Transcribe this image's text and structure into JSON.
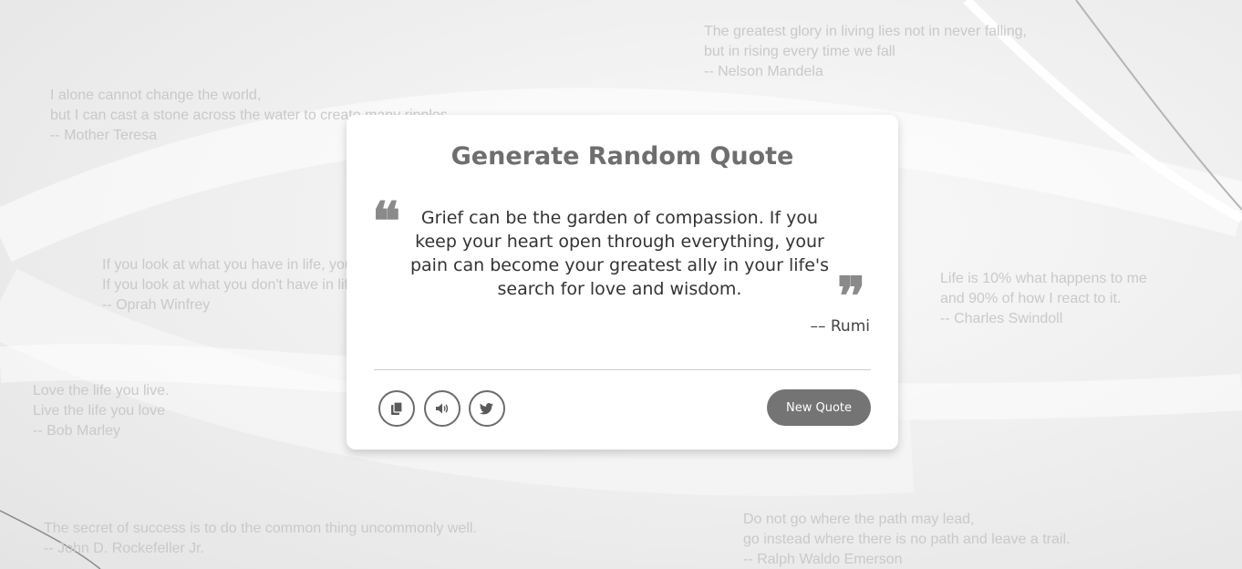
{
  "background_quotes": [
    {
      "lines": [
        "The greatest glory in living lies not in never falling,",
        "but in rising every time we fall",
        "-- Nelson Mandela"
      ]
    },
    {
      "lines": [
        "I alone cannot change the world,",
        "but I can cast a stone across the water to create many ripples",
        "-- Mother Teresa"
      ]
    },
    {
      "lines": [
        "If you look at what you have in life, you'll always have more.",
        "If you look at what you don't have in life, you'll never have enough.",
        "-- Oprah Winfrey"
      ]
    },
    {
      "lines": [
        "Life is 10% what happens to me",
        "and 90% of how I react to it.",
        "-- Charles Swindoll"
      ]
    },
    {
      "lines": [
        "Love the life you live.",
        "Live the life you love",
        "-- Bob Marley"
      ]
    },
    {
      "lines": [
        "The secret of success is to do the common thing uncommonly well.",
        "-- John D. Rockefeller Jr."
      ]
    },
    {
      "lines": [
        "Do not go where the path may lead,",
        "go instead where there is no path and leave a trail.",
        "-- Ralph Waldo Emerson"
      ]
    }
  ],
  "card": {
    "title": "Generate Random Quote",
    "quote_open_mark": "❝",
    "quote_close_mark": "❞",
    "quote": "Grief can be the garden of compassion. If you keep your heart open through everything, your pain can become your greatest ally in your life's search for love and wisdom.",
    "author": "–– Rumi",
    "icons": {
      "copy": "copy-icon",
      "speak": "speaker-icon",
      "tweet": "twitter-icon"
    },
    "new_quote_label": "New Quote"
  },
  "colors": {
    "accent": "#747474",
    "card_bg": "#ffffff",
    "background_text": "#c9c9c9"
  }
}
